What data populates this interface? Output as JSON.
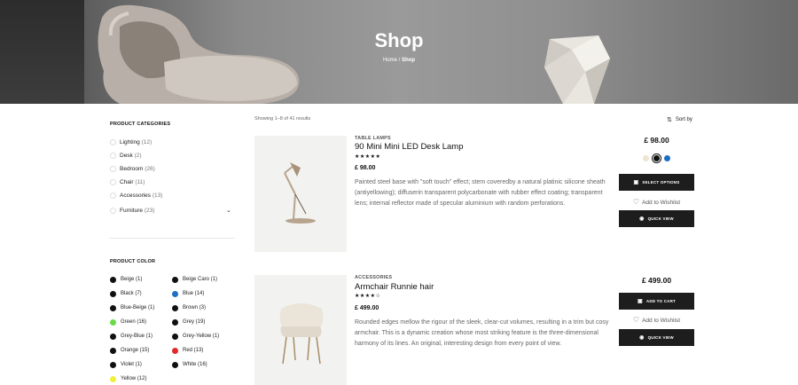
{
  "hero": {
    "title": "Shop",
    "crumb_home": "Home",
    "crumb_sep": " / ",
    "crumb_current": "Shop"
  },
  "sidebar": {
    "categories_title": "PRODUCT CATEGORIES",
    "categories": [
      {
        "label": "Lighting",
        "count": "(12)"
      },
      {
        "label": "Desk",
        "count": "(2)"
      },
      {
        "label": "Bedroom",
        "count": "(26)"
      },
      {
        "label": "Chair",
        "count": "(11)"
      },
      {
        "label": "Accessories",
        "count": "(13)"
      },
      {
        "label": "Furniture",
        "count": "(23)"
      }
    ],
    "color_title": "PRODUCT COLOR",
    "colors": [
      {
        "label": "Beige (1)",
        "color": "#111111"
      },
      {
        "label": "Beige Caro (1)",
        "color": "#111111"
      },
      {
        "label": "Black (7)",
        "color": "#111111"
      },
      {
        "label": "Blue (14)",
        "color": "#1e6fc4"
      },
      {
        "label": "Blue-Beige (1)",
        "color": "#111111"
      },
      {
        "label": "Brown (3)",
        "color": "#111111"
      },
      {
        "label": "Green (16)",
        "color": "#6bd94a"
      },
      {
        "label": "Grey (19)",
        "color": "#111111"
      },
      {
        "label": "Grey-Blue (1)",
        "color": "#111111"
      },
      {
        "label": "Grey-Yellow (1)",
        "color": "#111111"
      },
      {
        "label": "Orange (15)",
        "color": "#111111"
      },
      {
        "label": "Red (13)",
        "color": "#e02b2b"
      },
      {
        "label": "Violet (1)",
        "color": "#111111"
      },
      {
        "label": "White (16)",
        "color": "#111111"
      },
      {
        "label": "Yellow (12)",
        "color": "#f2ef3a"
      }
    ]
  },
  "toolbar": {
    "showing": "Showing 1–8 of 41 results",
    "sort_label": "Sort by"
  },
  "products": [
    {
      "category": "TABLE LAMPS",
      "name": "90 Mini Mini LED Desk Lamp",
      "stars": "★★★★★",
      "price": "£ 98.00",
      "description": "Painted steel base with \"soft touch\" effect; stem coveredby a natural platinic silicone sheath (antiyellowing); diffuserin transparent polycarbonate with rubber effect coating; transparent lens; internal reflector made of specular aluminium with random perforations.",
      "price_large": "£ 98.00",
      "swatches": [
        "#efe3d3",
        "#111111",
        "#1e6fc4"
      ],
      "primary_button": "SELECT OPTIONS",
      "wishlist": "Add to Wishlist",
      "quick_view": "QUICK VIEW"
    },
    {
      "category": "ACCESSORIES",
      "name": "Armchair Runnie hair",
      "stars": "★★★★☆",
      "price": "£ 499.00",
      "description": "Rounded edges mellow the rigour of the sleek, clear-cut volumes, resulting in a trim but cosy armchair. This is a dynamic creation whose most striking feature is the three-dimensional harmony of its lines. An original, interesting design from every point of view.",
      "price_large": "£ 499.00",
      "primary_button": "ADD TO CART",
      "wishlist": "Add to Wishlist",
      "quick_view": "QUICK VIEW"
    }
  ]
}
